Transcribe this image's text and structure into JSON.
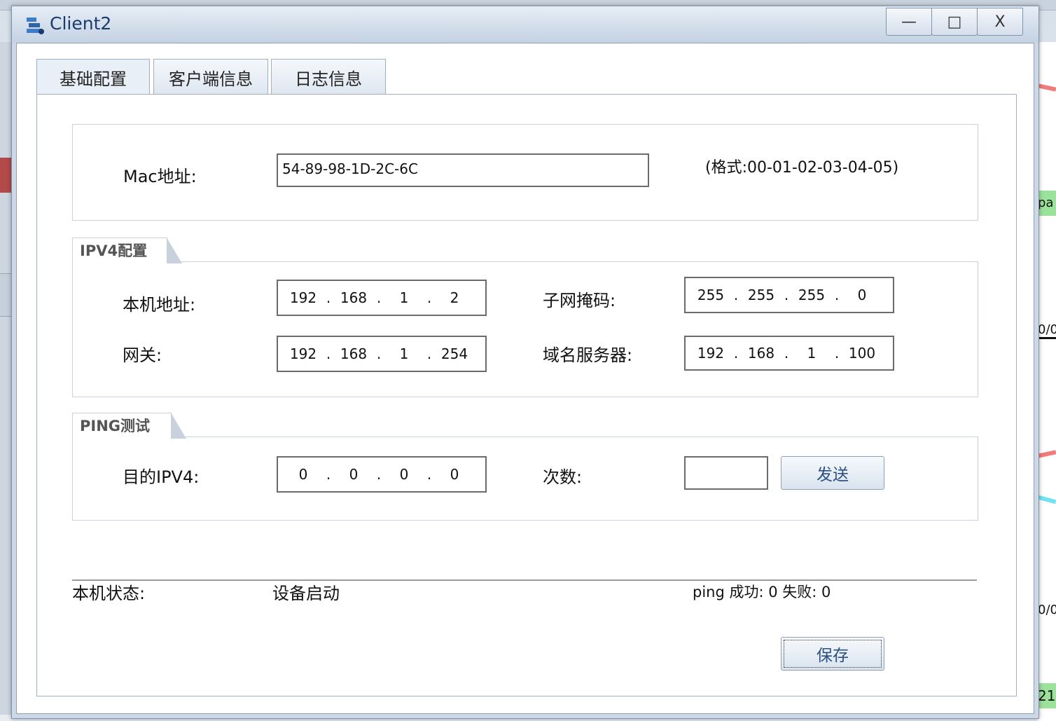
{
  "window": {
    "title": "Client2",
    "minimize_glyph": "—",
    "maximize_glyph": "□",
    "close_glyph": "X"
  },
  "tabs": [
    {
      "label": "基础配置",
      "active": true
    },
    {
      "label": "客户端信息",
      "active": false
    },
    {
      "label": "日志信息",
      "active": false
    }
  ],
  "mac": {
    "label": "Mac地址:",
    "value": "54-89-98-1D-2C-6C",
    "format_hint": "(格式:00-01-02-03-04-05)"
  },
  "ipv4": {
    "group_title": "IPV4配置",
    "host_label": "本机地址:",
    "host": [
      "192",
      "168",
      "1",
      "2"
    ],
    "mask_label": "子网掩码:",
    "mask": [
      "255",
      "255",
      "255",
      "0"
    ],
    "gateway_label": "网关:",
    "gateway": [
      "192",
      "168",
      "1",
      "254"
    ],
    "dns_label": "域名服务器:",
    "dns": [
      "192",
      "168",
      "1",
      "100"
    ]
  },
  "ping": {
    "group_title": "PING测试",
    "dest_label": "目的IPV4:",
    "dest": [
      "0",
      "0",
      "0",
      "0"
    ],
    "count_label": "次数:",
    "count_value": "",
    "send_label": "发送"
  },
  "status": {
    "label": "本机状态:",
    "value": "设备启动",
    "ping_result": "ping 成功: 0 失败: 0"
  },
  "save_label": "保存",
  "background": {
    "green1": "pa",
    "mono1": "0/0",
    "mono2": "0/0",
    "green2": "21"
  },
  "colors": {
    "title_text": "#1b3a6d",
    "button_text": "#2b4f86",
    "accent_green": "#9be29b"
  }
}
